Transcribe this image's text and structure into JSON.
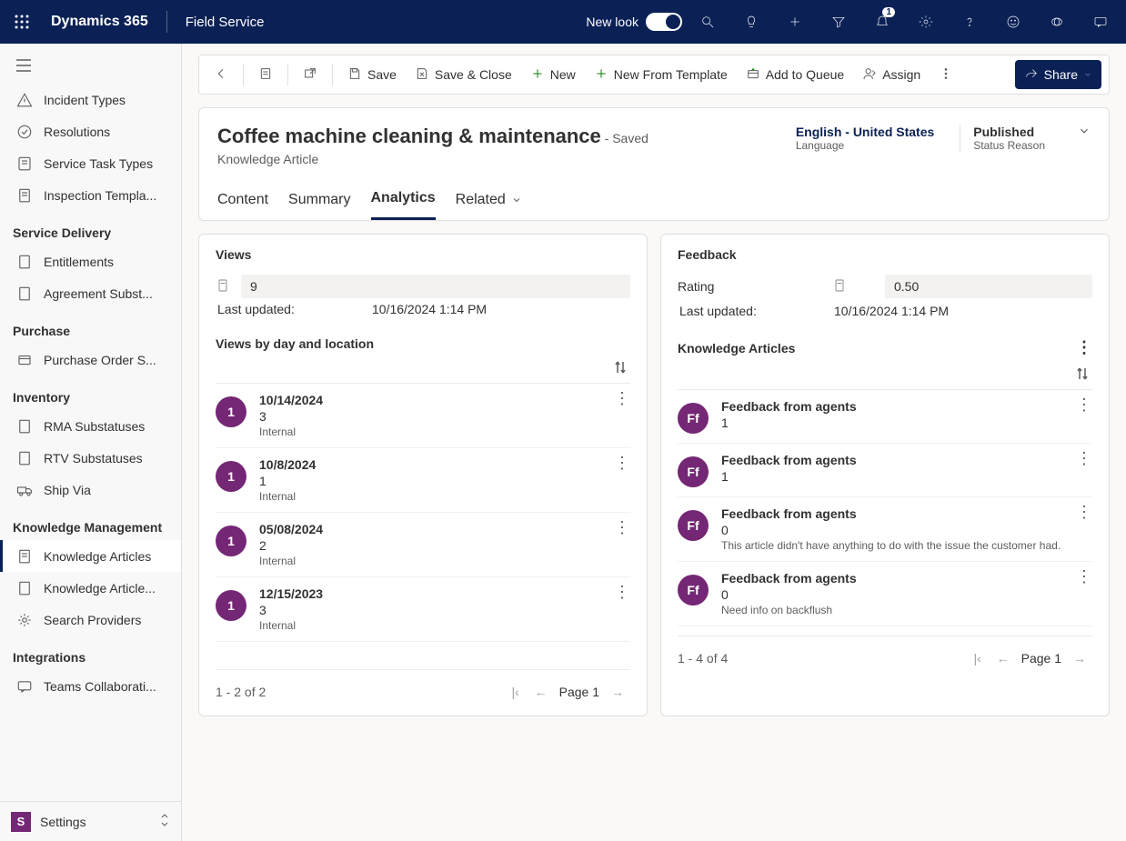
{
  "topbar": {
    "brand": "Dynamics 365",
    "app": "Field Service",
    "new_look_label": "New look",
    "notification_count": "1"
  },
  "sidebar": {
    "groups": [
      {
        "items": [
          {
            "label": "Incident Types",
            "icon": "alert"
          },
          {
            "label": "Resolutions",
            "icon": "check"
          },
          {
            "label": "Service Task Types",
            "icon": "task"
          },
          {
            "label": "Inspection Templa...",
            "icon": "doc"
          }
        ]
      },
      {
        "title": "Service Delivery",
        "items": [
          {
            "label": "Entitlements",
            "icon": "doc"
          },
          {
            "label": "Agreement Subst...",
            "icon": "doc"
          }
        ]
      },
      {
        "title": "Purchase",
        "items": [
          {
            "label": "Purchase Order S...",
            "icon": "po"
          }
        ]
      },
      {
        "title": "Inventory",
        "items": [
          {
            "label": "RMA Substatuses",
            "icon": "doc"
          },
          {
            "label": "RTV Substatuses",
            "icon": "doc"
          },
          {
            "label": "Ship Via",
            "icon": "truck"
          }
        ]
      },
      {
        "title": "Knowledge Management",
        "items": [
          {
            "label": "Knowledge Articles",
            "icon": "doc",
            "active": true
          },
          {
            "label": "Knowledge Article...",
            "icon": "doc"
          },
          {
            "label": "Search Providers",
            "icon": "gear"
          }
        ]
      },
      {
        "title": "Integrations",
        "items": [
          {
            "label": "Teams Collaborati...",
            "icon": "chat"
          }
        ]
      }
    ],
    "area_initial": "S",
    "area_label": "Settings"
  },
  "command_bar": {
    "save": "Save",
    "save_close": "Save & Close",
    "new": "New",
    "new_template": "New From Template",
    "add_queue": "Add to Queue",
    "assign": "Assign",
    "share": "Share"
  },
  "header": {
    "title": "Coffee machine cleaning & maintenance",
    "saved_suffix": "- Saved",
    "entity": "Knowledge Article",
    "lang_val": "English - United States",
    "lang_lbl": "Language",
    "status_val": "Published",
    "status_lbl": "Status Reason",
    "tabs": {
      "content": "Content",
      "summary": "Summary",
      "analytics": "Analytics",
      "related": "Related"
    }
  },
  "views_card": {
    "title": "Views",
    "value": "9",
    "last_updated_label": "Last updated:",
    "last_updated_value": "10/16/2024 1:14 PM",
    "subtitle": "Views by day and location",
    "rows": [
      {
        "badge": "1",
        "date": "10/14/2024",
        "count": "3",
        "loc": "Internal"
      },
      {
        "badge": "1",
        "date": "10/8/2024",
        "count": "1",
        "loc": "Internal"
      },
      {
        "badge": "1",
        "date": "05/08/2024",
        "count": "2",
        "loc": "Internal"
      },
      {
        "badge": "1",
        "date": "12/15/2023",
        "count": "3",
        "loc": "Internal"
      }
    ],
    "pager_range": "1 - 2 of 2",
    "pager_page": "Page 1"
  },
  "feedback_card": {
    "title": "Feedback",
    "rating_label": "Rating",
    "rating_value": "0.50",
    "last_updated_label": "Last updated:",
    "last_updated_value": "10/16/2024 1:14 PM",
    "subtitle": "Knowledge Articles",
    "rows": [
      {
        "badge": "Ff",
        "title": "Feedback from agents",
        "count": "1",
        "note": ""
      },
      {
        "badge": "Ff",
        "title": "Feedback from agents",
        "count": "1",
        "note": ""
      },
      {
        "badge": "Ff",
        "title": "Feedback from agents",
        "count": "0",
        "note": "This article didn't have anything to do with the issue the customer had."
      },
      {
        "badge": "Ff",
        "title": "Feedback from agents",
        "count": "0",
        "note": "Need info on backflush"
      }
    ],
    "pager_range": "1 - 4 of 4",
    "pager_page": "Page 1"
  }
}
